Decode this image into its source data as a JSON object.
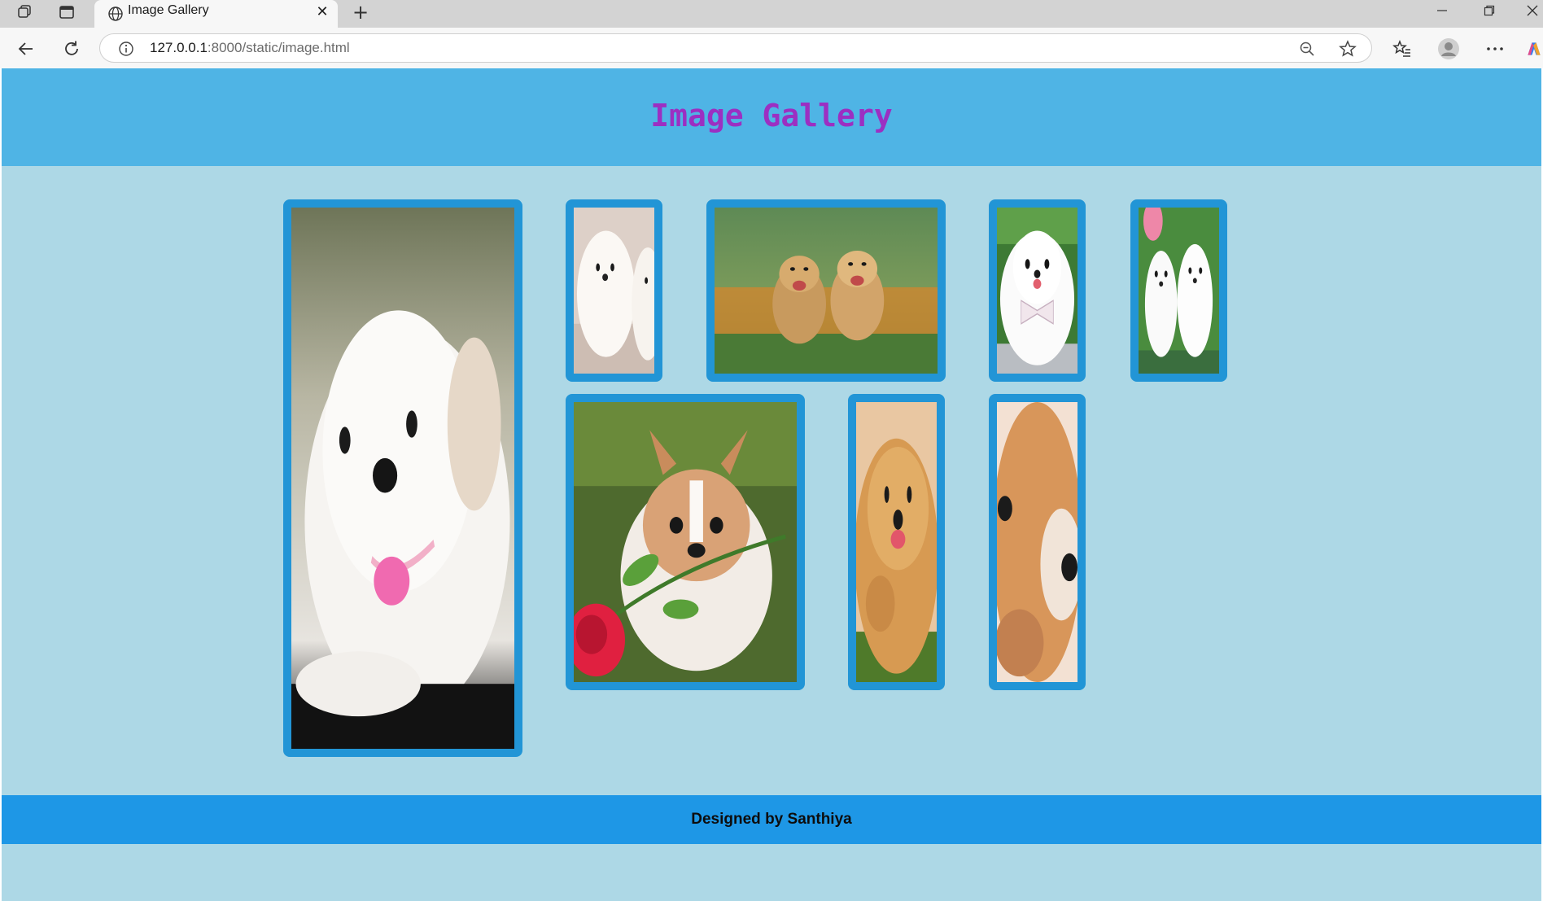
{
  "browser": {
    "tab_title": "Image Gallery",
    "new_tab_symbol": "+",
    "close_symbol": "✕",
    "url_host": "127.0.0.1",
    "url_rest": ":8000/static/image.html"
  },
  "page": {
    "title": "Image Gallery",
    "footer_text": "Designed by Santhiya",
    "colors": {
      "header_bg": "#4fb4e5",
      "body_bg": "#add8e6",
      "footer_bg": "#1e97e6",
      "title": "#9c2fc2",
      "tile_border": "#2295d6"
    }
  },
  "gallery": {
    "images": [
      {
        "name": "white-maltese-puppy-with-pink-heart-tag"
      },
      {
        "name": "two-white-pomeranian-puppies"
      },
      {
        "name": "two-golden-retriever-puppies-in-flowers"
      },
      {
        "name": "white-pomeranian-with-bow-tie"
      },
      {
        "name": "two-white-puppies-in-garden"
      },
      {
        "name": "corgi-puppy-with-red-rose"
      },
      {
        "name": "golden-retriever-puppy-close-up"
      },
      {
        "name": "corgi-puppy-face-close-up"
      }
    ]
  }
}
